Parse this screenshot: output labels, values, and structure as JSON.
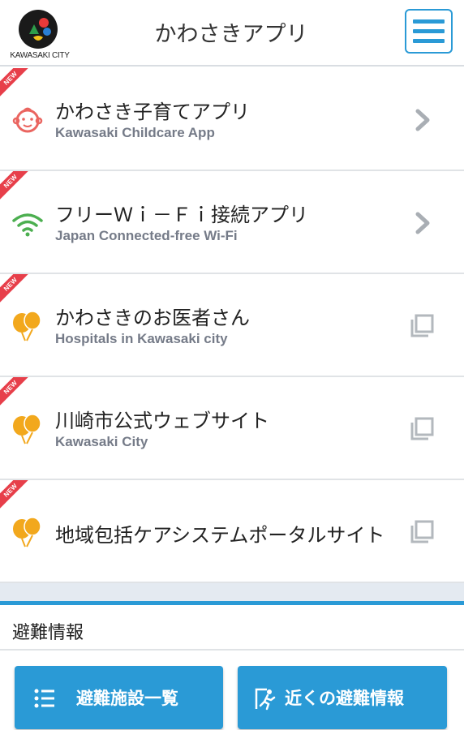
{
  "header": {
    "logo_text": "KAWASAKI CITY",
    "title": "かわさきアプリ",
    "menu_icon": "hamburger-menu-icon"
  },
  "items": [
    {
      "badge": "NEW",
      "title": "かわさき子育てアプリ",
      "subtitle": "Kawasaki Childcare App",
      "icon": "baby-face-icon",
      "action": "chevron-right-icon"
    },
    {
      "badge": "NEW",
      "title": "フリーＷｉ－Ｆｉ接続アプリ",
      "subtitle": "Japan Connected-free Wi-Fi",
      "icon": "wifi-icon",
      "action": "chevron-right-icon"
    },
    {
      "badge": "NEW",
      "title": "かわさきのお医者さん",
      "subtitle": "Hospitals in Kawasaki city",
      "icon": "balloons-icon",
      "action": "external-window-icon"
    },
    {
      "badge": "NEW",
      "title": "川崎市公式ウェブサイト",
      "subtitle": "Kawasaki City",
      "icon": "balloons-icon",
      "action": "external-window-icon"
    },
    {
      "badge": "NEW",
      "title": "地域包括ケアシステムポータルサイト",
      "icon": "balloons-icon",
      "action": "external-window-icon"
    }
  ],
  "evacuation": {
    "title": "避難情報",
    "buttons": [
      {
        "label": "避難施設一覧",
        "icon": "list-icon"
      },
      {
        "label": "近くの避難情報",
        "icon": "evacuation-exit-icon"
      }
    ]
  },
  "colors": {
    "accent": "#2a9ad6",
    "badge": "#e73f4a",
    "childcare_icon": "#ea6560",
    "wifi_icon": "#4caf50",
    "balloon_icon": "#f2a81d"
  }
}
